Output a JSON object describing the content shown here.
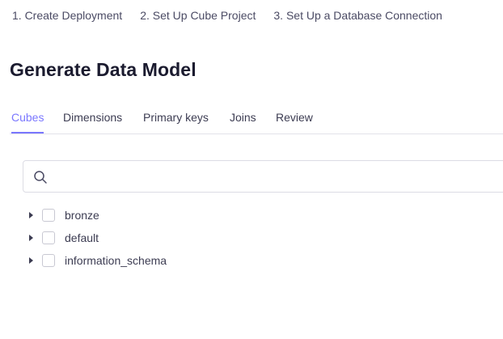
{
  "stepper": {
    "steps": [
      "1. Create Deployment",
      "2. Set Up Cube Project",
      "3. Set Up a Database Connection"
    ]
  },
  "page": {
    "title": "Generate Data Model"
  },
  "tabs": [
    {
      "label": "Cubes",
      "active": true
    },
    {
      "label": "Dimensions",
      "active": false
    },
    {
      "label": "Primary keys",
      "active": false
    },
    {
      "label": "Joins",
      "active": false
    },
    {
      "label": "Review",
      "active": false
    }
  ],
  "search": {
    "value": "",
    "placeholder": "",
    "icon": "search-icon"
  },
  "schemas": [
    {
      "label": "bronze",
      "checked": false,
      "expanded": false
    },
    {
      "label": "default",
      "checked": false,
      "expanded": false
    },
    {
      "label": "information_schema",
      "checked": false,
      "expanded": false
    }
  ],
  "colors": {
    "accent": "#7a77ff",
    "text": "#3c3c52",
    "border": "#dcdce4"
  }
}
